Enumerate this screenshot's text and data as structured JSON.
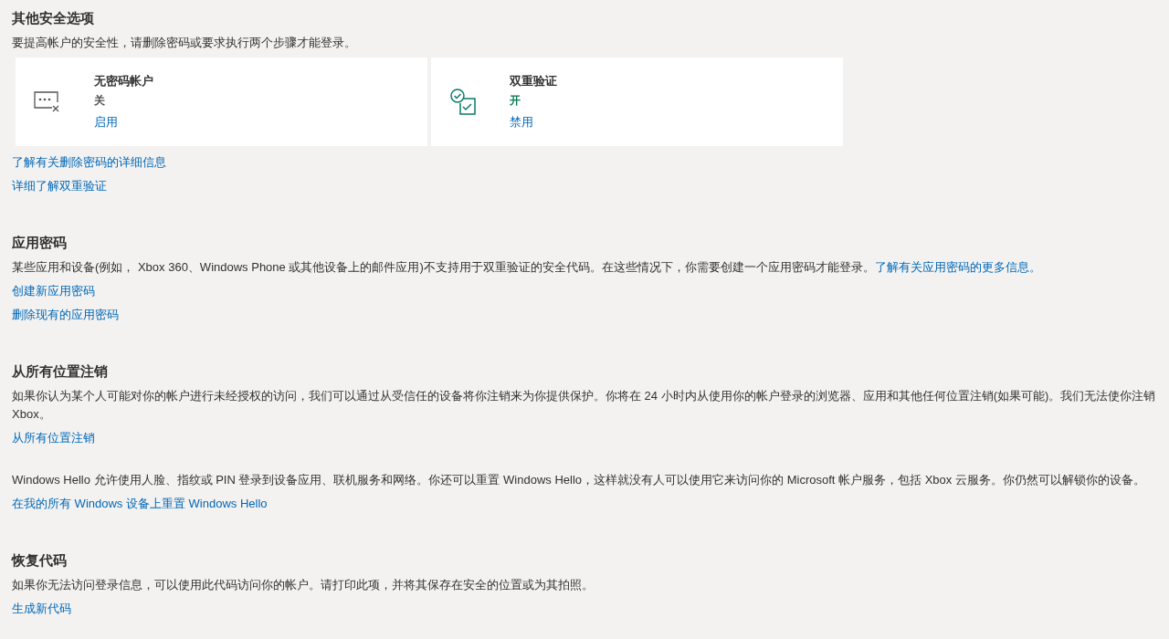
{
  "sections": [
    {
      "title": "其他安全选项",
      "blocks": [
        {
          "text": "要提高帐户的安全性，请删除密码或要求执行两个步骤才能登录。",
          "cards": [
            {
              "kind": "passwordless",
              "name": "无密码帐户",
              "status": "关",
              "on": false,
              "action": "启用"
            },
            {
              "kind": "two-step",
              "name": "双重验证",
              "status": "开",
              "on": true,
              "action": "禁用"
            }
          ],
          "links": [
            "了解有关删除密码的详细信息",
            "详细了解双重验证"
          ]
        }
      ]
    },
    {
      "title": "应用密码",
      "blocks": [
        {
          "text": "某些应用和设备(例如， Xbox 360、Windows Phone 或其他设备上的邮件应用)不支持用于双重验证的安全代码。在这些情况下，你需要创建一个应用密码才能登录。",
          "inline_link": "了解有关应用密码的更多信息。",
          "links": [
            "创建新应用密码",
            "删除现有的应用密码"
          ]
        }
      ]
    },
    {
      "title": "从所有位置注销",
      "blocks": [
        {
          "text": "如果你认为某个人可能对你的帐户进行未经授权的访问，我们可以通过从受信任的设备将你注销来为你提供保护。你将在 24 小时内从使用你的帐户登录的浏览器、应用和其他任何位置注销(如果可能)。我们无法使你注销 Xbox。",
          "links": [
            "从所有位置注销"
          ]
        },
        {
          "text": "Windows Hello 允许使用人脸、指纹或 PIN 登录到设备应用、联机服务和网络。你还可以重置 Windows Hello，这样就没有人可以使用它来访问你的 Microsoft 帐户服务，包括 Xbox 云服务。你仍然可以解锁你的设备。",
          "links": [
            "在我的所有 Windows 设备上重置 Windows Hello"
          ]
        }
      ]
    },
    {
      "title": "恢复代码",
      "blocks": [
        {
          "text": "如果你无法访问登录信息，可以使用此代码访问你的帐户。请打印此项，并将其保存在安全的位置或为其拍照。",
          "links": [
            "生成新代码"
          ]
        }
      ]
    }
  ]
}
